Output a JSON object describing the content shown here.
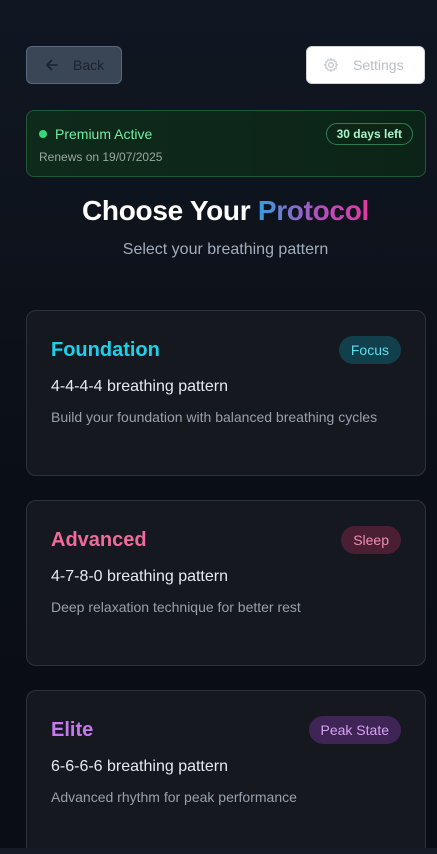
{
  "header": {
    "back_label": "Back",
    "settings_label": "Settings",
    "back_icon": "arrow-left-icon",
    "settings_icon": "gear-icon"
  },
  "premium": {
    "status": "Premium Active",
    "renews": "Renews on 19/07/2025",
    "days_left": "30 days left",
    "accent_color": "#34d97b"
  },
  "heading": {
    "title_part1": "Choose Your ",
    "title_part2": "Protocol",
    "subtitle": "Select your breathing pattern"
  },
  "protocols": [
    {
      "name": "Foundation",
      "badge": "Focus",
      "pattern": "4-4-4-4 breathing pattern",
      "description": "Build your foundation with balanced breathing cycles",
      "color": "#1fd0ea"
    },
    {
      "name": "Advanced",
      "badge": "Sleep",
      "pattern": "4-7-8-0 breathing pattern",
      "description": "Deep relaxation technique for better rest",
      "color": "#f06a9b"
    },
    {
      "name": "Elite",
      "badge": "Peak State",
      "pattern": "6-6-6-6 breathing pattern",
      "description": "Advanced rhythm for peak performance",
      "color": "#c678ee"
    }
  ]
}
